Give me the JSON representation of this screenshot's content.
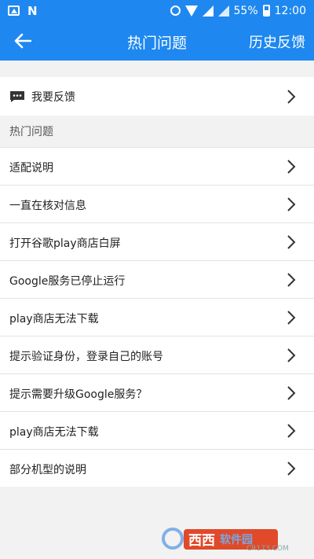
{
  "status_bar": {
    "battery": "55%",
    "time": "12:00"
  },
  "app_bar": {
    "title": "热门问题",
    "action": "历史反馈"
  },
  "feedback": {
    "label": "我要反馈"
  },
  "section": {
    "header": "热门问题"
  },
  "items": [
    {
      "label": "适配说明"
    },
    {
      "label": "一直在核对信息"
    },
    {
      "label": "打开谷歌play商店白屏"
    },
    {
      "label": "Google服务已停止运行"
    },
    {
      "label": "play商店无法下载"
    },
    {
      "label": "提示验证身份，登录自己的账号"
    },
    {
      "label": "提示需要升级Google服务？"
    },
    {
      "label": "play商店无法下载"
    },
    {
      "label": "部分机型的说明"
    }
  ],
  "watermark": {
    "brand": "西西软件园",
    "site": "CR173.COM"
  },
  "colors": {
    "primary": "#1e88f0",
    "background": "#f2f2f2"
  }
}
